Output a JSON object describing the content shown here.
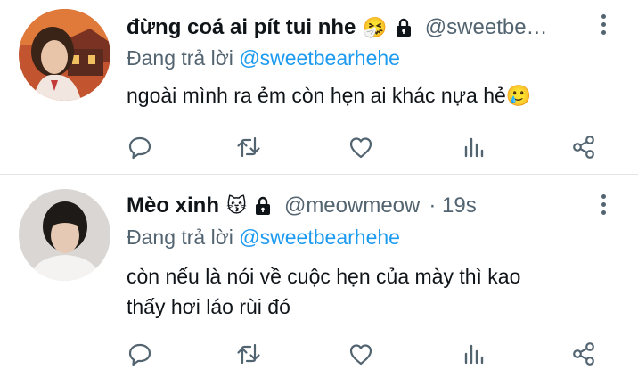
{
  "tweets": [
    {
      "display_name": "đừng coá ai pít tui nhe",
      "name_emoji": "🤧",
      "handle": "@sweetbe…",
      "time": "",
      "replying_prefix": "Đang trả lời",
      "replying_to": "@sweetbearhehe",
      "text_lines": [
        "ngoài mình ra ẻm còn hẹn ai khác nựa hẻ🥲"
      ],
      "avatar_colors": {
        "bg": "#c2542f",
        "hair": "#3a2418",
        "face": "#e8c4a8"
      }
    },
    {
      "display_name": "Mèo xinh",
      "name_emoji": "😽",
      "handle": "@meowmeow",
      "time": "· 19s",
      "replying_prefix": "Đang trả lời",
      "replying_to": "@sweetbearhehe",
      "text_lines": [
        "còn nếu là nói về cuộc hẹn của mày thì kao",
        "thấy hơi láo rùi đó"
      ],
      "avatar_colors": {
        "bg": "#d9d6d3",
        "hair": "#1e1a17",
        "face": "#e6c9b4"
      }
    }
  ],
  "actions": [
    "reply-icon",
    "retweet-icon",
    "like-icon",
    "views-icon",
    "share-icon"
  ],
  "colors": {
    "accent": "#1d9bf0",
    "secondary_text": "#536471",
    "primary_text": "#0f1419",
    "divider": "#e3e6e8"
  }
}
